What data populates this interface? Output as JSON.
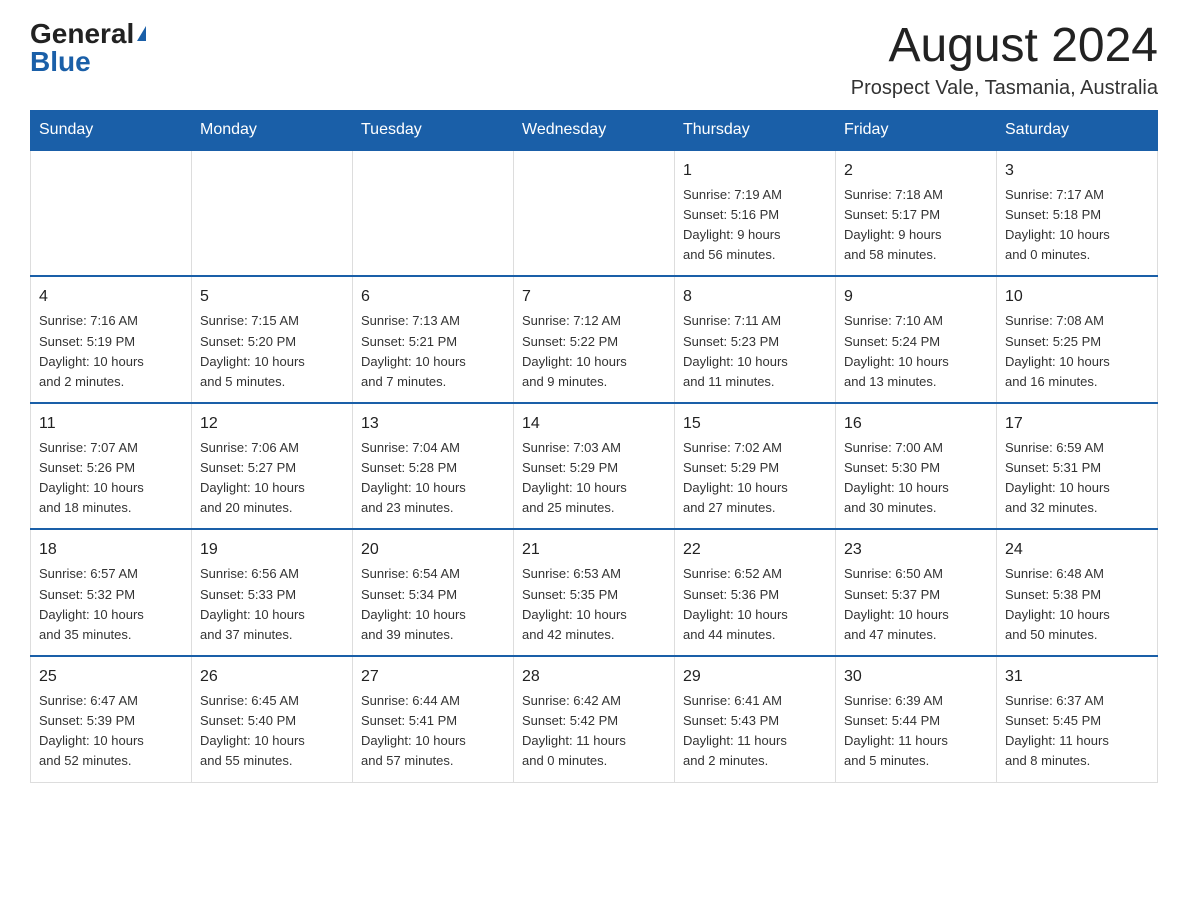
{
  "logo": {
    "general": "General",
    "blue": "Blue"
  },
  "header": {
    "month": "August 2024",
    "location": "Prospect Vale, Tasmania, Australia"
  },
  "weekdays": [
    "Sunday",
    "Monday",
    "Tuesday",
    "Wednesday",
    "Thursday",
    "Friday",
    "Saturday"
  ],
  "weeks": [
    [
      {
        "day": "",
        "info": ""
      },
      {
        "day": "",
        "info": ""
      },
      {
        "day": "",
        "info": ""
      },
      {
        "day": "",
        "info": ""
      },
      {
        "day": "1",
        "info": "Sunrise: 7:19 AM\nSunset: 5:16 PM\nDaylight: 9 hours\nand 56 minutes."
      },
      {
        "day": "2",
        "info": "Sunrise: 7:18 AM\nSunset: 5:17 PM\nDaylight: 9 hours\nand 58 minutes."
      },
      {
        "day": "3",
        "info": "Sunrise: 7:17 AM\nSunset: 5:18 PM\nDaylight: 10 hours\nand 0 minutes."
      }
    ],
    [
      {
        "day": "4",
        "info": "Sunrise: 7:16 AM\nSunset: 5:19 PM\nDaylight: 10 hours\nand 2 minutes."
      },
      {
        "day": "5",
        "info": "Sunrise: 7:15 AM\nSunset: 5:20 PM\nDaylight: 10 hours\nand 5 minutes."
      },
      {
        "day": "6",
        "info": "Sunrise: 7:13 AM\nSunset: 5:21 PM\nDaylight: 10 hours\nand 7 minutes."
      },
      {
        "day": "7",
        "info": "Sunrise: 7:12 AM\nSunset: 5:22 PM\nDaylight: 10 hours\nand 9 minutes."
      },
      {
        "day": "8",
        "info": "Sunrise: 7:11 AM\nSunset: 5:23 PM\nDaylight: 10 hours\nand 11 minutes."
      },
      {
        "day": "9",
        "info": "Sunrise: 7:10 AM\nSunset: 5:24 PM\nDaylight: 10 hours\nand 13 minutes."
      },
      {
        "day": "10",
        "info": "Sunrise: 7:08 AM\nSunset: 5:25 PM\nDaylight: 10 hours\nand 16 minutes."
      }
    ],
    [
      {
        "day": "11",
        "info": "Sunrise: 7:07 AM\nSunset: 5:26 PM\nDaylight: 10 hours\nand 18 minutes."
      },
      {
        "day": "12",
        "info": "Sunrise: 7:06 AM\nSunset: 5:27 PM\nDaylight: 10 hours\nand 20 minutes."
      },
      {
        "day": "13",
        "info": "Sunrise: 7:04 AM\nSunset: 5:28 PM\nDaylight: 10 hours\nand 23 minutes."
      },
      {
        "day": "14",
        "info": "Sunrise: 7:03 AM\nSunset: 5:29 PM\nDaylight: 10 hours\nand 25 minutes."
      },
      {
        "day": "15",
        "info": "Sunrise: 7:02 AM\nSunset: 5:29 PM\nDaylight: 10 hours\nand 27 minutes."
      },
      {
        "day": "16",
        "info": "Sunrise: 7:00 AM\nSunset: 5:30 PM\nDaylight: 10 hours\nand 30 minutes."
      },
      {
        "day": "17",
        "info": "Sunrise: 6:59 AM\nSunset: 5:31 PM\nDaylight: 10 hours\nand 32 minutes."
      }
    ],
    [
      {
        "day": "18",
        "info": "Sunrise: 6:57 AM\nSunset: 5:32 PM\nDaylight: 10 hours\nand 35 minutes."
      },
      {
        "day": "19",
        "info": "Sunrise: 6:56 AM\nSunset: 5:33 PM\nDaylight: 10 hours\nand 37 minutes."
      },
      {
        "day": "20",
        "info": "Sunrise: 6:54 AM\nSunset: 5:34 PM\nDaylight: 10 hours\nand 39 minutes."
      },
      {
        "day": "21",
        "info": "Sunrise: 6:53 AM\nSunset: 5:35 PM\nDaylight: 10 hours\nand 42 minutes."
      },
      {
        "day": "22",
        "info": "Sunrise: 6:52 AM\nSunset: 5:36 PM\nDaylight: 10 hours\nand 44 minutes."
      },
      {
        "day": "23",
        "info": "Sunrise: 6:50 AM\nSunset: 5:37 PM\nDaylight: 10 hours\nand 47 minutes."
      },
      {
        "day": "24",
        "info": "Sunrise: 6:48 AM\nSunset: 5:38 PM\nDaylight: 10 hours\nand 50 minutes."
      }
    ],
    [
      {
        "day": "25",
        "info": "Sunrise: 6:47 AM\nSunset: 5:39 PM\nDaylight: 10 hours\nand 52 minutes."
      },
      {
        "day": "26",
        "info": "Sunrise: 6:45 AM\nSunset: 5:40 PM\nDaylight: 10 hours\nand 55 minutes."
      },
      {
        "day": "27",
        "info": "Sunrise: 6:44 AM\nSunset: 5:41 PM\nDaylight: 10 hours\nand 57 minutes."
      },
      {
        "day": "28",
        "info": "Sunrise: 6:42 AM\nSunset: 5:42 PM\nDaylight: 11 hours\nand 0 minutes."
      },
      {
        "day": "29",
        "info": "Sunrise: 6:41 AM\nSunset: 5:43 PM\nDaylight: 11 hours\nand 2 minutes."
      },
      {
        "day": "30",
        "info": "Sunrise: 6:39 AM\nSunset: 5:44 PM\nDaylight: 11 hours\nand 5 minutes."
      },
      {
        "day": "31",
        "info": "Sunrise: 6:37 AM\nSunset: 5:45 PM\nDaylight: 11 hours\nand 8 minutes."
      }
    ]
  ]
}
